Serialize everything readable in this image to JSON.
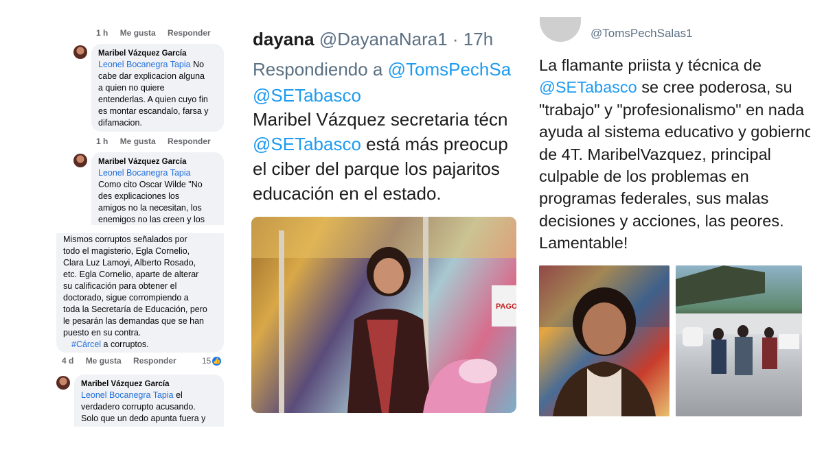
{
  "facebook": {
    "top_meta": {
      "time": "1 h",
      "like": "Me gusta",
      "reply": "Responder"
    },
    "comments_top": [
      {
        "author": "Maribel Vázquez García",
        "mention": "Leonel Bocanegra Tapia",
        "lines": [
          "No",
          "cabe dar explicacion alguna",
          "a quien no quiere",
          "entenderlas. A quien cuyo fin",
          "es montar escandalo, farsa y",
          "difamacion."
        ],
        "meta": {
          "time": "1 h",
          "like": "Me gusta",
          "reply": "Responder"
        }
      },
      {
        "author": "Maribel Vázquez García",
        "mention": "Leonel Bocanegra Tapia",
        "lines": [
          "Como cito Oscar Wilde  \"No",
          "des explicaciones los",
          "amigos no la necesitan, los",
          "enemigos no las creen y los"
        ]
      }
    ],
    "comment_bottom": {
      "lines": [
        "Mismos corruptos señalados por",
        "todo el magisterio, Egla Cornelio,",
        "Clara Luz Lamoyi, Alberto Rosado,",
        "etc. Egla Cornelio, aparte de alterar",
        "su calificación para obtener el",
        "doctorado, sigue corrompiendo a",
        "toda la Secretaría de Educación, pero",
        "le pesarán las demandas que se han",
        "puesto en su contra."
      ],
      "hashtag": "#Cárcel",
      "hashtag_tail": " a corruptos.",
      "meta": {
        "time": "4 d",
        "like": "Me gusta",
        "reply": "Responder"
      },
      "like_count": "15"
    },
    "reply_bottom": {
      "author": "Maribel Vázquez García",
      "mention": "Leonel Bocanegra Tapia",
      "lines": [
        "el",
        "verdadero corrupto acusando.",
        "Solo que un dedo apunta fuera y"
      ]
    }
  },
  "tweet_middle": {
    "display_name": "dayana",
    "handle": "@DayanaNara1",
    "time": "· 17h",
    "reply_prefix": "Respondiendo a ",
    "reply_to_1": "@TomsPechSa",
    "reply_to_2": "@SETabasco",
    "text_line1": "Maribel Vázquez secretaria técn",
    "text_mention": "@SETabasco",
    "text_line2_tail": " está más preocup",
    "text_line3": "el ciber del parque los pajaritos",
    "text_line4": "educación en el estado.",
    "photo_sign": "PAGO"
  },
  "tweet_right": {
    "handle": "@TomsPechSalas1",
    "text_before_mention": "La flamante priista y técnica de ",
    "mention": "@SETabasco",
    "text_after_mention": " se cree poderosa, su \"trabajo\" y \"profesionalismo\" en nada ayuda al sistema educativo y gobierno de 4T. MaribelVazquez, principal culpable de los problemas en programas federales, sus malas decisiones y acciones, las peores. Lamentable!"
  }
}
